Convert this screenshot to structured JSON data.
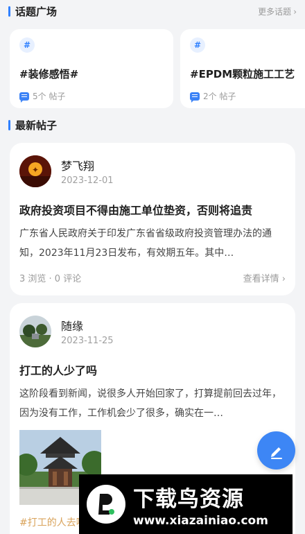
{
  "topics_section": {
    "title": "话题广场",
    "more_label": "更多话题",
    "cards": [
      {
        "hash": "#",
        "name": "#装修感悟#",
        "post_count": "5个 帖子"
      },
      {
        "hash": "#",
        "name": "#EPDM颗粒施工工艺",
        "post_count": "2个 帖子"
      }
    ]
  },
  "latest_section": {
    "title": "最新帖子"
  },
  "posts": [
    {
      "author": "梦飞翔",
      "date": "2023-12-01",
      "title": "政府投资项目不得由施工单位垫资，否则将追责",
      "body": "广东省人民政府关于印发广东省省级政府投资管理办法的通知，2023年11月23日发布，有效期五年。其中…",
      "stats": "3 浏览 · 0 评论",
      "detail_label": "查看详情"
    },
    {
      "author": "随缘",
      "date": "2023-11-25",
      "title": "打工的人少了吗",
      "body": "这阶段看到新闻，说很多人开始回家了，打算提前回去过年，因为没有工作，工作机会少了很多，确实在一…",
      "tag": "#打工的人去哪了#"
    }
  ],
  "watermark": {
    "title": "下载鸟资源",
    "url": "www.xiazainiao.com"
  },
  "colors": {
    "accent": "#2f80ff",
    "fab": "#3d86f5",
    "tag": "#d9a35b",
    "background": "#f3f4f6"
  },
  "icons": {
    "topic_badge": "hash-icon",
    "post_count": "chat-bubble-icon",
    "fab": "edit-pencil-icon",
    "more": "chevron-right-icon"
  }
}
